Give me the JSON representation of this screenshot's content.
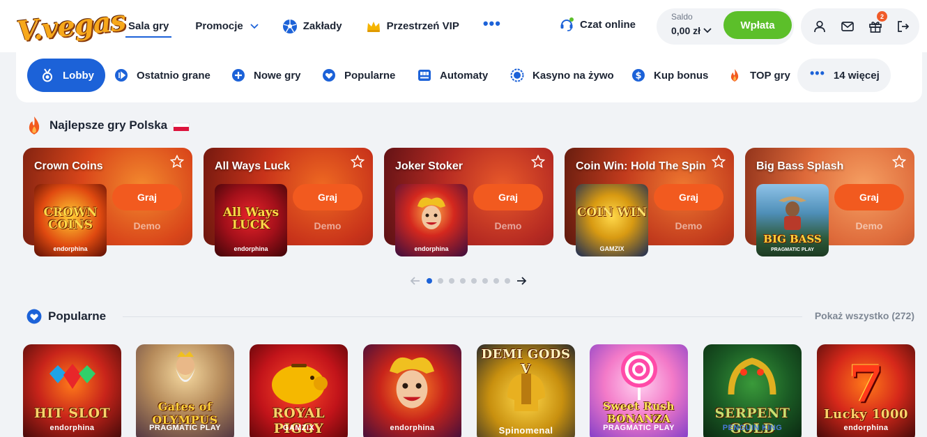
{
  "header": {
    "logo_text": "V.vegas",
    "nav": [
      {
        "label": "Sala gry"
      },
      {
        "label": "Promocje"
      },
      {
        "label": "Zakłady"
      },
      {
        "label": "Przestrzeń VIP"
      }
    ],
    "more_dots": "•••",
    "chat_label": "Czat online",
    "balance_label": "Saldo",
    "balance_value": "0,00 zł",
    "deposit_label": "Wpłata",
    "gift_count": "2"
  },
  "categories": [
    {
      "label": "Lobby"
    },
    {
      "label": "Ostatnio grane"
    },
    {
      "label": "Nowe gry"
    },
    {
      "label": "Popularne"
    },
    {
      "label": "Automaty"
    },
    {
      "label": "Kasyno na żywo"
    },
    {
      "label": "Kup bonus"
    },
    {
      "label": "TOP gry"
    },
    {
      "label": "14 więcej"
    }
  ],
  "featured": {
    "title": "Najlepsze gry Polska",
    "cards": [
      {
        "title": "Crown Coins",
        "thumb_name": "CROWN COINS",
        "provider": "endorphina",
        "play": "Graj",
        "demo": "Demo"
      },
      {
        "title": "All Ways Luck",
        "thumb_name": "All Ways LUCK",
        "provider": "endorphina",
        "play": "Graj",
        "demo": "Demo"
      },
      {
        "title": "Joker Stoker",
        "thumb_name": "",
        "provider": "endorphina",
        "play": "Graj",
        "demo": "Demo"
      },
      {
        "title": "Coin Win: Hold The Spin",
        "thumb_name": "COIN WIN",
        "provider": "GAMZIX",
        "play": "Graj",
        "demo": "Demo"
      },
      {
        "title": "Big Bass Splash",
        "thumb_name": "BIG BASS",
        "provider": "PRAGMATIC PLAY",
        "play": "Graj",
        "demo": "Demo"
      }
    ],
    "pages": 8,
    "active_page": 1
  },
  "popular": {
    "title": "Popularne",
    "show_all": "Pokaż wszystko (272)",
    "games": [
      {
        "name": "HIT SLOT",
        "provider": "endorphina"
      },
      {
        "name": "Gates of OLYMPUS",
        "provider": "PRAGMATIC PLAY"
      },
      {
        "name": "ROYAL PIGGY",
        "provider": "GAMZIX"
      },
      {
        "name": "",
        "provider": "endorphina"
      },
      {
        "name": "DEMI GODS V",
        "provider": "Spinomenal"
      },
      {
        "name": "Sweet Rush BONANZA",
        "provider": "PRAGMATIC PLAY"
      },
      {
        "name": "SERPENT GOLD",
        "provider": "PENGUIN KING"
      },
      {
        "name": "Lucky 1000",
        "provider": "endorphina"
      }
    ]
  },
  "colors": {
    "accent": "#1c62d8",
    "deposit": "#5cbf2a",
    "play_button": "#f25a1f",
    "background": "#f1f3f6"
  },
  "icons": {
    "nav": [
      "football-icon",
      "crown-icon",
      "headset-icon"
    ],
    "user": [
      "user-icon",
      "mail-icon",
      "gift-icon",
      "logout-icon"
    ],
    "categories": [
      "medal-icon",
      "recent-icon",
      "plus-icon",
      "heart-icon",
      "slot-machine-icon",
      "live-icon",
      "dollar-icon",
      "fire-icon",
      "dots-icon"
    ]
  }
}
